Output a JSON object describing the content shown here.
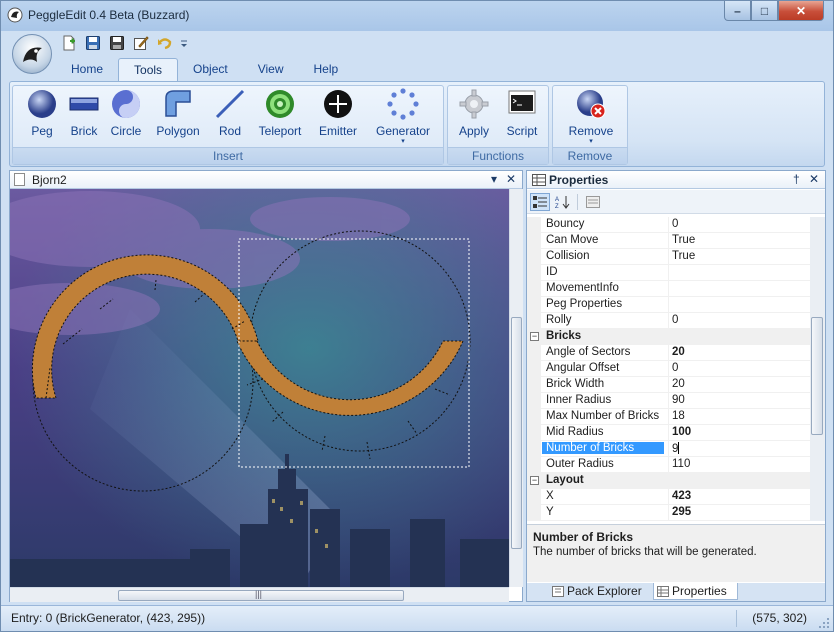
{
  "window": {
    "title": "PeggleEdit 0.4 Beta (Buzzard)",
    "minimize": "–",
    "maximize": "□",
    "close": "✕"
  },
  "ribbon": {
    "tabs": [
      {
        "label": "Home",
        "active": false
      },
      {
        "label": "Tools",
        "active": true
      },
      {
        "label": "Object",
        "active": false
      },
      {
        "label": "View",
        "active": false
      },
      {
        "label": "Help",
        "active": false
      }
    ],
    "groups": {
      "insert": {
        "label": "Insert",
        "buttons": [
          {
            "label": "Peg",
            "icon": "peg-icon"
          },
          {
            "label": "Brick",
            "icon": "brick-icon"
          },
          {
            "label": "Circle",
            "icon": "circle-icon"
          },
          {
            "label": "Polygon",
            "icon": "polygon-icon"
          },
          {
            "label": "Rod",
            "icon": "rod-icon"
          },
          {
            "label": "Teleport",
            "icon": "teleport-icon"
          },
          {
            "label": "Emitter",
            "icon": "emitter-icon"
          },
          {
            "label": "Generator",
            "icon": "generator-icon",
            "dropdown": "▾"
          }
        ]
      },
      "functions": {
        "label": "Functions",
        "buttons": [
          {
            "label": "Apply",
            "icon": "gear-icon"
          },
          {
            "label": "Script",
            "icon": "script-icon"
          }
        ]
      },
      "remove": {
        "label": "Remove",
        "buttons": [
          {
            "label": "Remove",
            "icon": "remove-icon",
            "dropdown": "▾"
          }
        ]
      }
    }
  },
  "document": {
    "tab_label": "Bjorn2",
    "dropdown": "▾",
    "close": "✕",
    "scroll_grip": "|||"
  },
  "properties": {
    "title": "Properties",
    "pin": "†",
    "close": "✕",
    "rows": [
      {
        "kind": "prop",
        "name": "Bouncy",
        "value": "0"
      },
      {
        "kind": "prop",
        "name": "Can Move",
        "value": "True"
      },
      {
        "kind": "prop",
        "name": "Collision",
        "value": "True"
      },
      {
        "kind": "prop",
        "name": "ID",
        "value": ""
      },
      {
        "kind": "prop",
        "name": "MovementInfo",
        "value": ""
      },
      {
        "kind": "prop",
        "name": "Peg Properties",
        "value": ""
      },
      {
        "kind": "prop",
        "name": "Rolly",
        "value": "0"
      },
      {
        "kind": "cat",
        "name": "Bricks",
        "toggle": "−"
      },
      {
        "kind": "prop",
        "name": "Angle of Sectors",
        "value": "20",
        "bold": true
      },
      {
        "kind": "prop",
        "name": "Angular Offset",
        "value": "0"
      },
      {
        "kind": "prop",
        "name": "Brick Width",
        "value": "20"
      },
      {
        "kind": "prop",
        "name": "Inner Radius",
        "value": "90"
      },
      {
        "kind": "prop",
        "name": "Max Number of Bricks",
        "value": "18"
      },
      {
        "kind": "prop",
        "name": "Mid Radius",
        "value": "100",
        "bold": true
      },
      {
        "kind": "prop",
        "name": "Number of Bricks",
        "value": "9",
        "selected": true
      },
      {
        "kind": "prop",
        "name": "Outer Radius",
        "value": "110"
      },
      {
        "kind": "cat",
        "name": "Layout",
        "toggle": "−"
      },
      {
        "kind": "prop",
        "name": "X",
        "value": "423",
        "bold": true
      },
      {
        "kind": "prop",
        "name": "Y",
        "value": "295",
        "bold": true
      }
    ],
    "description": {
      "title": "Number of Bricks",
      "body": "The number of bricks that will be generated."
    },
    "bottom_tabs": [
      {
        "label": "Pack Explorer",
        "active": false
      },
      {
        "label": "Properties",
        "active": true
      }
    ]
  },
  "status": {
    "left": "Entry: 0 (BrickGenerator, (423, 295))",
    "right": "(575, 302)"
  },
  "colors": {
    "brick": "#c08038",
    "selection": "#3399ff",
    "ribbon_text": "#15428b"
  }
}
